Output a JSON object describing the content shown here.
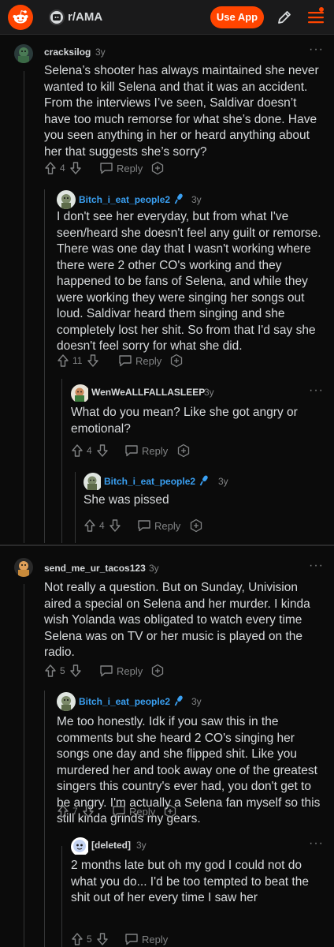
{
  "header": {
    "subreddit": "r/AMA",
    "use_app_label": "Use App",
    "icons": [
      "reddit-logo",
      "subreddit-icon",
      "pencil-icon",
      "menu-icon"
    ]
  },
  "comments": [
    {
      "username": "cracksilog",
      "age": "3y",
      "body": "Selena’s shooter has always maintained she never wanted to kill Selena and that it was an accident. From the interviews I’ve seen, Saldivar doesn’t have too much remorse for what she’s done. Have you seen anything in her or heard anything about her that suggests she’s sorry?",
      "score": "4",
      "reply_label": "Reply"
    },
    {
      "username": "Bitch_i_eat_people2",
      "age": "3y",
      "body": "I don't see her everyday, but from what I've seen/heard she doesn't feel any guilt or remorse. There was one day that I wasn't working where there were 2 other CO's working and they happened to be fans of Selena, and while they were working they were singing her songs out loud. Saldivar heard them singing and she completely lost her shit. So from that I'd say she doesn't feel sorry for what she did.",
      "score": "11",
      "reply_label": "Reply"
    },
    {
      "username": "WenWeALLFALLASLEEP",
      "age": "3y",
      "body": "What do you mean? Like she got angry or emotional?",
      "score": "4",
      "reply_label": "Reply"
    },
    {
      "username": "Bitch_i_eat_people2",
      "age": "3y",
      "body": "She was pissed",
      "score": "4",
      "reply_label": "Reply"
    },
    {
      "username": "send_me_ur_tacos123",
      "age": "3y",
      "body": "Not really a question. But on Sunday, Univision aired a special on Selena and her murder. I kinda wish Yolanda was obligated to watch every time Selena was on TV or her music is played on the radio.",
      "score": "5",
      "reply_label": "Reply"
    },
    {
      "username": "Bitch_i_eat_people2",
      "age": "3y",
      "body": "Me too honestly. Idk if you saw this in the comments but she heard 2 CO's singing her songs one day and she flipped shit. Like you murdered her and took away one of the greatest singers this country's ever had, you don't get to be angry. I'm actually a Selena fan myself so this still kinda grinds my gears.",
      "score": "7",
      "reply_label": "Reply"
    },
    {
      "username": "[deleted]",
      "age": "3y",
      "body": "2 months late but oh my god I could not do what you do... I'd be too tempted to beat the shit out of her every time I saw her",
      "score": "5",
      "reply_label": "Reply"
    }
  ],
  "colors": {
    "accent": "#ff4500",
    "op_blue": "#3aa0f2",
    "bg": "#0b0b0b",
    "text": "#d7dadc",
    "muted": "#818384"
  }
}
